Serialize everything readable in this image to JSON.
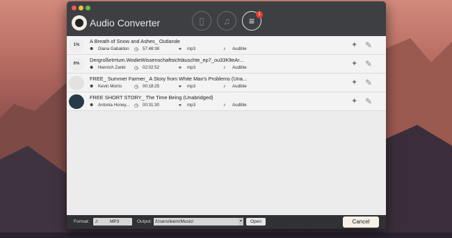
{
  "window": {
    "app_title": "Audio Converter",
    "badge_count": "1",
    "toolbar_icons": [
      "document-icon",
      "music-icon",
      "list-check-icon"
    ]
  },
  "items": [
    {
      "thumb_text": "",
      "title": "A Breath of Snow and Ashes_ Outlande",
      "author": "Diana Gabaldon",
      "duration": "57:48:38",
      "format": "mp3",
      "source": "Audible"
    },
    {
      "thumb_text": "6%",
      "title": "DergroßeIrrtum.WodieWissenschaftsichtäuschte_ep7_ou33KlteAr...",
      "author": "Heinrich Zankl",
      "duration": "02:02:52",
      "format": "mp3",
      "source": "Audible"
    },
    {
      "thumb_text": "",
      "title": "FREE_ Summer Farmer_ A Story from White Man's Problems (Una...",
      "author": "Kevin Morris",
      "duration": "00:18:25",
      "format": "mp3",
      "source": "Audible"
    },
    {
      "thumb_text": "",
      "title": "FREE SHORT STORY_ The Time Being (Unabridged)",
      "author": "Antonia Honey...",
      "duration": "00:31:30",
      "format": "mp3",
      "source": "Audible"
    }
  ],
  "first_thumb_progress": "1%",
  "bottom": {
    "format_label": "Format:",
    "format_value": "MP3",
    "output_label": "Output:",
    "output_path": "/Users/leem/Music/",
    "open_label": "Open",
    "cancel_label": "Cancel"
  },
  "colors": {
    "window_bg": "#3a3c40",
    "list_bg": "#ececec",
    "badge": "#e53b2f",
    "close": "#ee5b54",
    "minimize": "#f3bd3b",
    "zoom": "#5fc147"
  }
}
